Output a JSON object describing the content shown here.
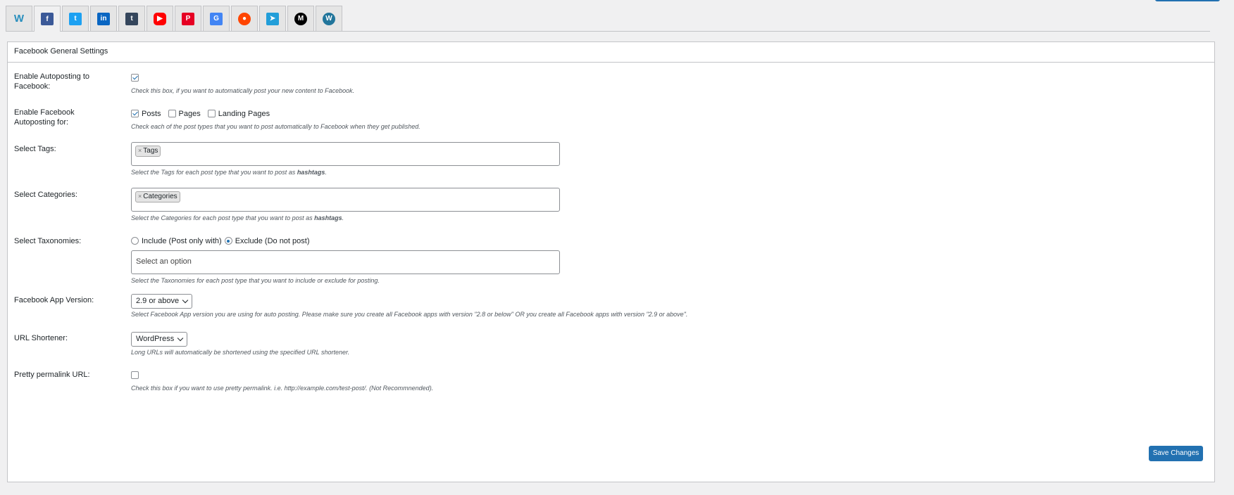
{
  "tabs": [
    {
      "name": "wpw",
      "glyph": "W",
      "color": "#2a8fbd",
      "text_color": "#2a8fbd"
    },
    {
      "name": "facebook",
      "glyph": "f",
      "color": "#3b5998"
    },
    {
      "name": "twitter",
      "glyph": "t",
      "color": "#1da1f2"
    },
    {
      "name": "linkedin",
      "glyph": "in",
      "color": "#0a66c2"
    },
    {
      "name": "tumblr",
      "glyph": "t",
      "color": "#35465c"
    },
    {
      "name": "youtube",
      "glyph": "▶",
      "color": "#ff0000"
    },
    {
      "name": "pinterest",
      "glyph": "P",
      "color": "#e60023"
    },
    {
      "name": "google-my-business",
      "glyph": "G",
      "color": "#4285f4"
    },
    {
      "name": "reddit",
      "glyph": "●",
      "color": "#ff4500"
    },
    {
      "name": "telegram",
      "glyph": "➤",
      "color": "#229ed9"
    },
    {
      "name": "medium",
      "glyph": "M",
      "color": "#000000"
    },
    {
      "name": "wordpress",
      "glyph": "W",
      "color": "#21759b"
    }
  ],
  "panel": {
    "title": "Facebook General Settings"
  },
  "settings": {
    "autopost": {
      "label": "Enable Autoposting to Facebook:",
      "checked": true,
      "desc": "Check this box, if you want to automatically post your new content to Facebook."
    },
    "post_types": {
      "label": "Enable Facebook Autoposting for:",
      "options": [
        {
          "label": "Posts",
          "checked": true
        },
        {
          "label": "Pages",
          "checked": false
        },
        {
          "label": "Landing Pages",
          "checked": false
        }
      ],
      "desc": "Check each of the post types that you want to post automatically to Facebook when they get published."
    },
    "tags": {
      "label": "Select Tags:",
      "chip": "Tags",
      "desc_pre": "Select the Tags for each post type that you want to post as ",
      "desc_bold": "hashtags",
      "desc_post": "."
    },
    "categories": {
      "label": "Select Categories:",
      "chip": "Categories",
      "desc_pre": "Select the Categories for each post type that you want to post as ",
      "desc_bold": "hashtags",
      "desc_post": "."
    },
    "taxonomies": {
      "label": "Select Taxonomies:",
      "radio_include": "Include (Post only with)",
      "radio_exclude": "Exclude (Do not post)",
      "selected": "exclude",
      "placeholder": "Select an option",
      "desc": "Select the Taxonomies for each post type that you want to include or exclude for posting."
    },
    "app_version": {
      "label": "Facebook App Version:",
      "value": "2.9 or above",
      "desc": "Select Facebook App version you are using for auto posting. Please make sure you create all Facebook apps with version \"2.8 or below\" OR you create all Facebook apps with version \"2.9 or above\"."
    },
    "shortener": {
      "label": "URL Shortener:",
      "value": "WordPress",
      "desc": "Long URLs will automatically be shortened using the specified URL shortener."
    },
    "pretty": {
      "label": "Pretty permalink URL:",
      "checked": false,
      "desc": "Check this box if you want to use pretty permalink. i.e. http://example.com/test-post/. (Not Recommnended)."
    }
  },
  "save_label": "Save Changes",
  "colors": {
    "accent": "#2271b1",
    "border": "#c3c4c7",
    "bg": "#f0f0f1"
  }
}
